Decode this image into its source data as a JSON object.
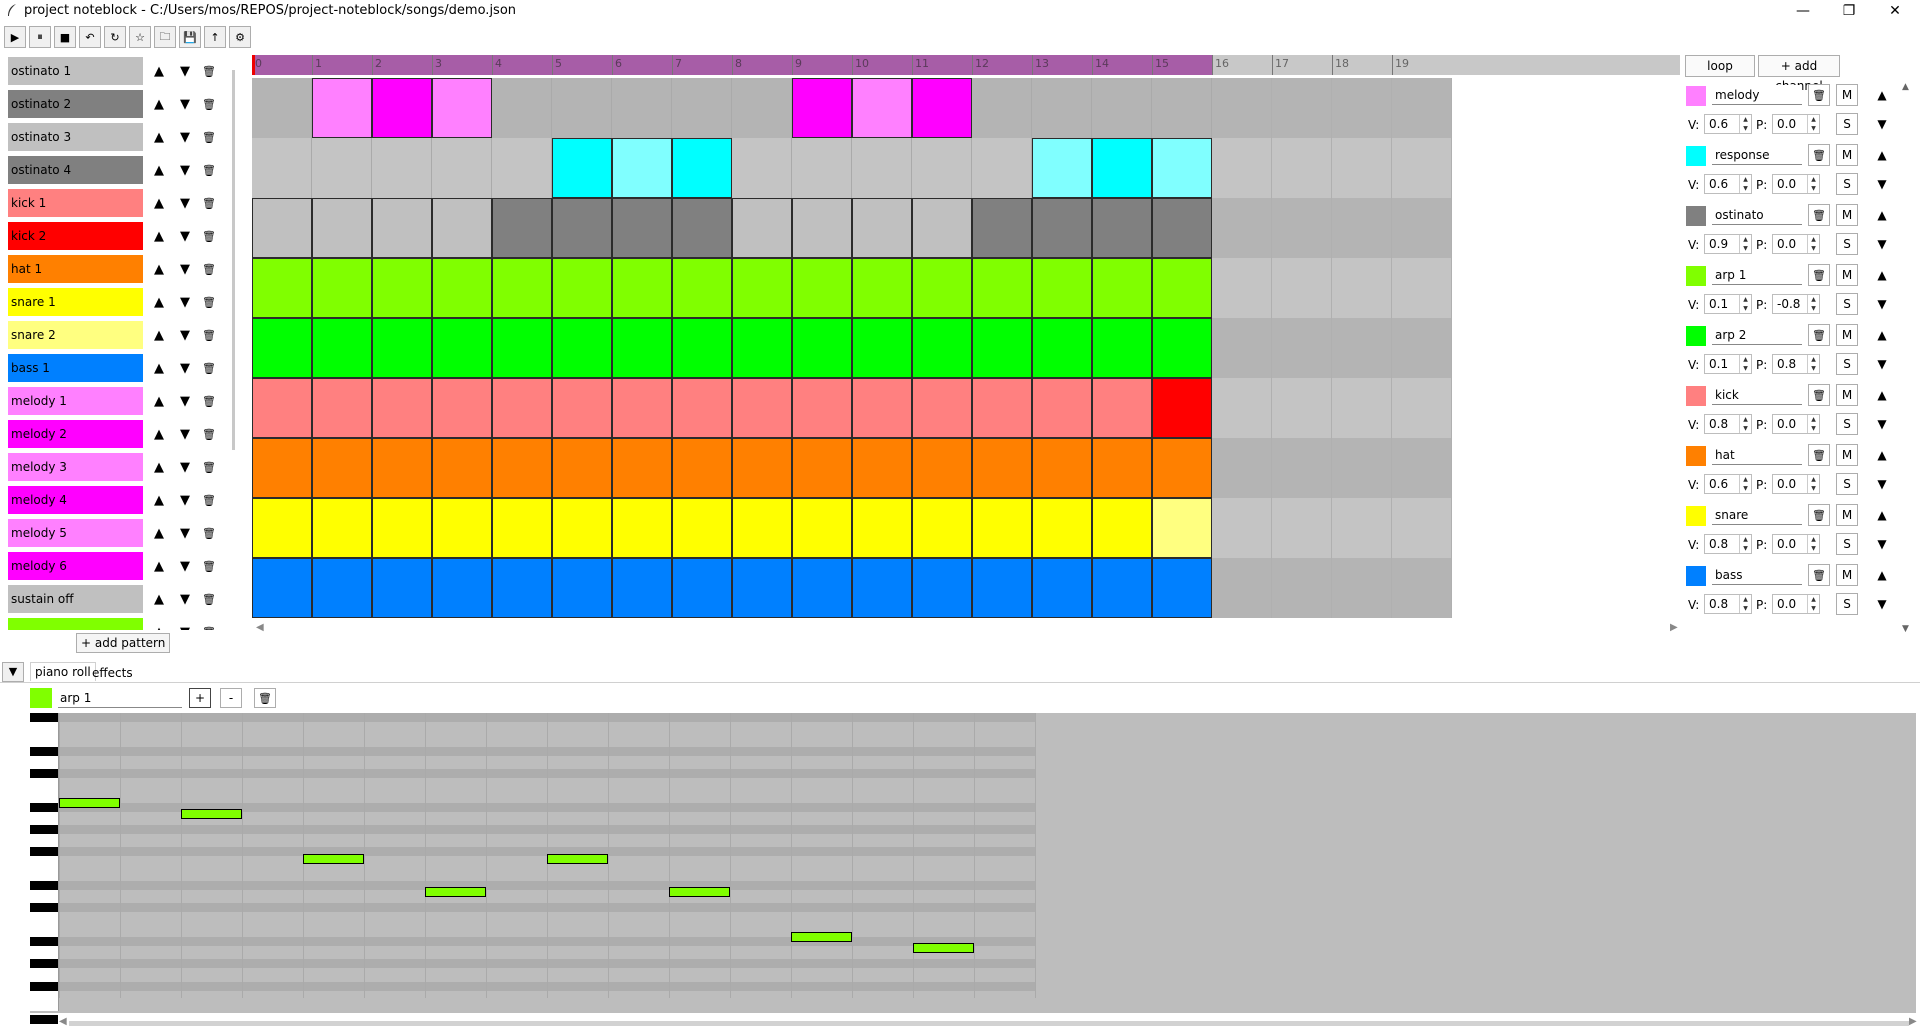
{
  "window": {
    "title": "project noteblock - C:/Users/mos/REPOS/project-noteblock/songs/demo.json",
    "controls": [
      "minimize",
      "maximize",
      "close"
    ]
  },
  "toolbar": {
    "buttons": [
      {
        "name": "play-icon",
        "glyph": "▶"
      },
      {
        "name": "pause-icon",
        "glyph": "⏸"
      },
      {
        "name": "stop-icon",
        "glyph": "■"
      },
      {
        "name": "undo-icon",
        "glyph": "↶"
      },
      {
        "name": "redo-icon",
        "glyph": "↻"
      },
      {
        "name": "star-icon",
        "glyph": "☆"
      },
      {
        "name": "open-folder-icon",
        "glyph": "🗀"
      },
      {
        "name": "save-icon",
        "glyph": "💾"
      },
      {
        "name": "export-icon",
        "glyph": "↑"
      },
      {
        "name": "settings-icon",
        "glyph": "⚙"
      }
    ]
  },
  "patterns": {
    "items": [
      {
        "label": "ostinato 1",
        "color": "#c0c0c0"
      },
      {
        "label": "ostinato 2",
        "color": "#808080"
      },
      {
        "label": "ostinato 3",
        "color": "#c0c0c0"
      },
      {
        "label": "ostinato 4",
        "color": "#808080"
      },
      {
        "label": "kick 1",
        "color": "#ff8080"
      },
      {
        "label": "kick 2",
        "color": "#ff0000"
      },
      {
        "label": "hat 1",
        "color": "#ff8000"
      },
      {
        "label": "snare 1",
        "color": "#ffff00"
      },
      {
        "label": "snare 2",
        "color": "#ffff80"
      },
      {
        "label": "bass 1",
        "color": "#0080ff"
      },
      {
        "label": "melody 1",
        "color": "#ff80ff"
      },
      {
        "label": "melody 2",
        "color": "#ff00ff"
      },
      {
        "label": "melody 3",
        "color": "#ff80ff"
      },
      {
        "label": "melody 4",
        "color": "#ff00ff"
      },
      {
        "label": "melody 5",
        "color": "#ff80ff"
      },
      {
        "label": "melody 6",
        "color": "#ff00ff"
      },
      {
        "label": "sustain off",
        "color": "#c0c0c0"
      },
      {
        "label": "",
        "color": "#80ff00"
      }
    ],
    "up_glyph": "▲",
    "down_glyph": "▼",
    "delete_glyph": "🗑",
    "add_label": "+ add pattern"
  },
  "timeline": {
    "labels": [
      "0",
      "1",
      "2",
      "3",
      "4",
      "5",
      "6",
      "7",
      "8",
      "9",
      "10",
      "11",
      "12",
      "13",
      "14",
      "15",
      "16",
      "17",
      "18",
      "19"
    ],
    "loop_end": 16
  },
  "sequence": {
    "rows": [
      [
        "",
        "#ff80ff",
        "#ff00ff",
        "#ff80ff",
        "",
        "",
        "",
        "",
        "",
        "#ff00ff",
        "#ff80ff",
        "#ff00ff",
        "",
        "",
        "",
        ""
      ],
      [
        "",
        "",
        "",
        "",
        "",
        "#00ffff",
        "#80ffff",
        "#00ffff",
        "",
        "",
        "",
        "",
        "",
        "#80ffff",
        "#00ffff",
        "#80ffff"
      ],
      [
        "#c0c0c0",
        "#c0c0c0",
        "#c0c0c0",
        "#c0c0c0",
        "#808080",
        "#808080",
        "#808080",
        "#808080",
        "#c0c0c0",
        "#c0c0c0",
        "#c0c0c0",
        "#c0c0c0",
        "#808080",
        "#808080",
        "#808080",
        "#808080"
      ],
      [
        "#80ff00",
        "#80ff00",
        "#80ff00",
        "#80ff00",
        "#80ff00",
        "#80ff00",
        "#80ff00",
        "#80ff00",
        "#80ff00",
        "#80ff00",
        "#80ff00",
        "#80ff00",
        "#80ff00",
        "#80ff00",
        "#80ff00",
        "#80ff00"
      ],
      [
        "#00ff00",
        "#00ff00",
        "#00ff00",
        "#00ff00",
        "#00ff00",
        "#00ff00",
        "#00ff00",
        "#00ff00",
        "#00ff00",
        "#00ff00",
        "#00ff00",
        "#00ff00",
        "#00ff00",
        "#00ff00",
        "#00ff00",
        "#00ff00"
      ],
      [
        "#ff8080",
        "#ff8080",
        "#ff8080",
        "#ff8080",
        "#ff8080",
        "#ff8080",
        "#ff8080",
        "#ff8080",
        "#ff8080",
        "#ff8080",
        "#ff8080",
        "#ff8080",
        "#ff8080",
        "#ff8080",
        "#ff8080",
        "#ff0000"
      ],
      [
        "#ff8000",
        "#ff8000",
        "#ff8000",
        "#ff8000",
        "#ff8000",
        "#ff8000",
        "#ff8000",
        "#ff8000",
        "#ff8000",
        "#ff8000",
        "#ff8000",
        "#ff8000",
        "#ff8000",
        "#ff8000",
        "#ff8000",
        "#ff8000"
      ],
      [
        "#ffff00",
        "#ffff00",
        "#ffff00",
        "#ffff00",
        "#ffff00",
        "#ffff00",
        "#ffff00",
        "#ffff00",
        "#ffff00",
        "#ffff00",
        "#ffff00",
        "#ffff00",
        "#ffff00",
        "#ffff00",
        "#ffff00",
        "#ffff80"
      ],
      [
        "#0080ff",
        "#0080ff",
        "#0080ff",
        "#0080ff",
        "#0080ff",
        "#0080ff",
        "#0080ff",
        "#0080ff",
        "#0080ff",
        "#0080ff",
        "#0080ff",
        "#0080ff",
        "#0080ff",
        "#0080ff",
        "#0080ff",
        "#0080ff"
      ]
    ]
  },
  "channels": {
    "loop_label": "loop",
    "add_label": "+ add channel",
    "mute_label": "M",
    "solo_label": "S",
    "v_label": "V:",
    "p_label": "P:",
    "items": [
      {
        "name": "melody",
        "color": "#ff80ff",
        "volume": "0.6",
        "pan": "0.0"
      },
      {
        "name": "response",
        "color": "#00ffff",
        "volume": "0.6",
        "pan": "0.0"
      },
      {
        "name": "ostinato",
        "color": "#808080",
        "volume": "0.9",
        "pan": "0.0"
      },
      {
        "name": "arp 1",
        "color": "#80ff00",
        "volume": "0.1",
        "pan": "-0.8"
      },
      {
        "name": "arp 2",
        "color": "#00ff00",
        "volume": "0.1",
        "pan": "0.8"
      },
      {
        "name": "kick",
        "color": "#ff8080",
        "volume": "0.8",
        "pan": "0.0"
      },
      {
        "name": "hat",
        "color": "#ff8000",
        "volume": "0.6",
        "pan": "0.0"
      },
      {
        "name": "snare",
        "color": "#ffff00",
        "volume": "0.8",
        "pan": "0.0"
      },
      {
        "name": "bass",
        "color": "#0080ff",
        "volume": "0.8",
        "pan": "0.0"
      }
    ]
  },
  "editor": {
    "collapse_glyph": "▼",
    "tabs": {
      "piano_roll": "piano roll",
      "effects": "effects"
    },
    "pattern_name": "arp 1",
    "pattern_color": "#80ff00",
    "plus_label": "+",
    "minus_label": "-",
    "notes": [
      {
        "step": 0,
        "pitch_row": 9
      },
      {
        "step": 2,
        "pitch_row": 10
      },
      {
        "step": 4,
        "pitch_row": 14
      },
      {
        "step": 6,
        "pitch_row": 17
      },
      {
        "step": 8,
        "pitch_row": 14
      },
      {
        "step": 10,
        "pitch_row": 17
      },
      {
        "step": 12,
        "pitch_row": 21
      },
      {
        "step": 14,
        "pitch_row": 22
      }
    ]
  }
}
